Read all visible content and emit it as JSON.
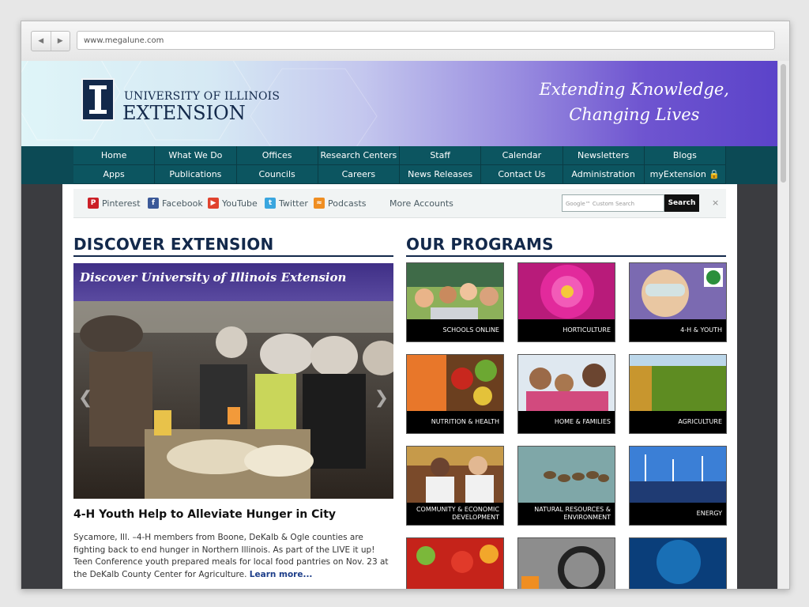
{
  "browser": {
    "url": "www.megalune.com"
  },
  "header": {
    "logo_line1": "UNIVERSITY OF ILLINOIS",
    "logo_line2": "EXTENSION",
    "tagline_line1": "Extending Knowledge,",
    "tagline_line2": "Changing Lives"
  },
  "nav": {
    "row1": [
      "Home",
      "What We Do",
      "Offices",
      "Research Centers",
      "Staff",
      "Calendar",
      "Newsletters",
      "Blogs"
    ],
    "row2": [
      "Apps",
      "Publications",
      "Councils",
      "Careers",
      "News Releases",
      "Contact Us",
      "Administration",
      "myExtension 🔒"
    ]
  },
  "social": {
    "pinterest": "Pinterest",
    "facebook": "Facebook",
    "youtube": "YouTube",
    "twitter": "Twitter",
    "podcasts": "Podcasts",
    "more": "More Accounts",
    "search_placeholder": "Google™ Custom Search",
    "search_button": "Search",
    "close": "×"
  },
  "discover": {
    "heading": "DISCOVER EXTENSION",
    "slide_title": "Discover University of Illinois Extension",
    "story_title": "4-H Youth Help to Alleviate Hunger in City",
    "story_body": "Sycamore, Ill. –4-H members from Boone, DeKalb & Ogle counties are fighting back to end hunger in Northern Illinois. As part of the LIVE it up! Teen Conference youth prepared meals for local food pantries on Nov. 23 at the DeKalb County Center for Agriculture.",
    "learn_more": "Learn more..."
  },
  "programs": {
    "heading": "OUR PROGRAMS",
    "tiles": [
      "SCHOOLS ONLINE",
      "HORTICULTURE",
      "4-H & YOUTH",
      "NUTRITION & HEALTH",
      "HOME & FAMILIES",
      "AGRICULTURE",
      "COMMUNITY & ECONOMIC DEVELOPMENT",
      "NATURAL RESOURCES & ENVIRONMENT",
      "ENERGY"
    ]
  },
  "colors": {
    "navy": "#13294b",
    "nav_teal": "#0c5560",
    "banner_purple": "#5b43c9"
  }
}
